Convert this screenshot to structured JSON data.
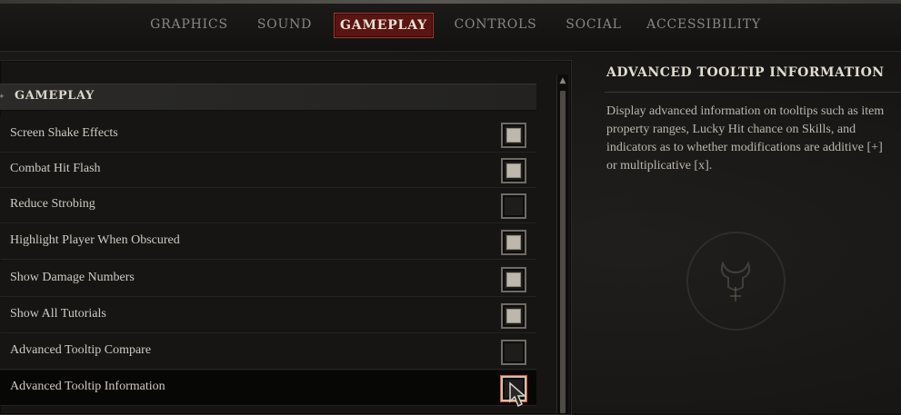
{
  "tabs": [
    {
      "label": "GRAPHICS",
      "active": false
    },
    {
      "label": "SOUND",
      "active": false
    },
    {
      "label": "GAMEPLAY",
      "active": true
    },
    {
      "label": "CONTROLS",
      "active": false
    },
    {
      "label": "SOCIAL",
      "active": false
    },
    {
      "label": "ACCESSIBILITY",
      "active": false
    }
  ],
  "section": {
    "title": "GAMEPLAY"
  },
  "settings": [
    {
      "label": "Screen Shake Effects",
      "checked": true
    },
    {
      "label": "Combat Hit Flash",
      "checked": true
    },
    {
      "label": "Reduce Strobing",
      "checked": false
    },
    {
      "label": "Highlight Player When Obscured",
      "checked": true
    },
    {
      "label": "Show Damage Numbers",
      "checked": true
    },
    {
      "label": "Show All Tutorials",
      "checked": true
    },
    {
      "label": "Advanced Tooltip Compare",
      "checked": false
    },
    {
      "label": "Advanced Tooltip Information",
      "checked": false
    }
  ],
  "info": {
    "title": "ADVANCED TOOLTIP INFORMATION",
    "description": "Display advanced information on tooltips such as item property ranges, Lucky Hit chance on Skills, and indicators as to whether modifications are additive [+] or multiplicative [x]."
  },
  "colors": {
    "active_tab_bg": "#5a1512",
    "active_tab_border": "#a33a2c"
  }
}
